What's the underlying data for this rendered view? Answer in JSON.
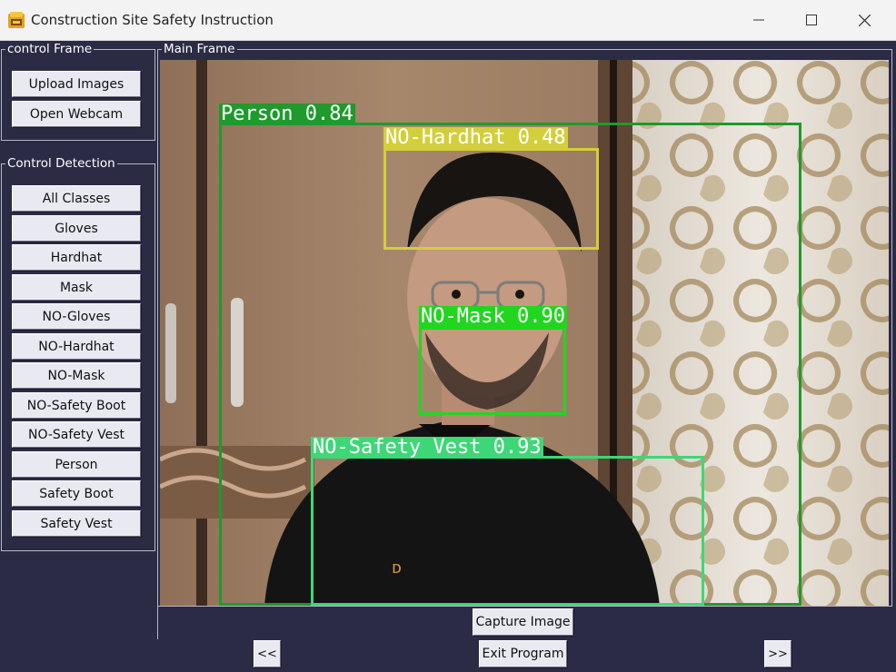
{
  "window": {
    "title": "Construction Site Safety Instruction",
    "controls": [
      "minimize-icon",
      "maximize-icon",
      "close-icon"
    ]
  },
  "control_frame": {
    "legend": "control Frame",
    "buttons": [
      "Upload Images",
      "Open Webcam"
    ]
  },
  "detection_frame": {
    "legend": "Control Detection",
    "buttons": [
      "All Classes",
      "Gloves",
      "Hardhat",
      "Mask",
      "NO-Gloves",
      "NO-Hardhat",
      "NO-Mask",
      "NO-Safety Boot",
      "NO-Safety Vest",
      "Person",
      "Safety Boot",
      "Safety Vest"
    ]
  },
  "main_frame": {
    "legend": "Main Frame",
    "detections": [
      {
        "label": "Person 0.84",
        "class": "Person",
        "confidence": 0.84,
        "color": "#1f9a2c"
      },
      {
        "label": "NO-Hardhat 0.48",
        "class": "NO-Hardhat",
        "confidence": 0.48,
        "color": "#d2cf3a"
      },
      {
        "label": "NO-Mask 0.90",
        "class": "NO-Mask",
        "confidence": 0.9,
        "color": "#22d620"
      },
      {
        "label": "NO-Safety Vest 0.93",
        "class": "NO-Safety Vest",
        "confidence": 0.93,
        "color": "#3ed777"
      }
    ]
  },
  "actions": {
    "capture": "Capture Image",
    "exit": "Exit Program",
    "prev": "<<",
    "next": ">>"
  },
  "colors": {
    "background": "#2c2b46",
    "button": "#e9e9f2",
    "titlebar": "#f3f3f3"
  }
}
